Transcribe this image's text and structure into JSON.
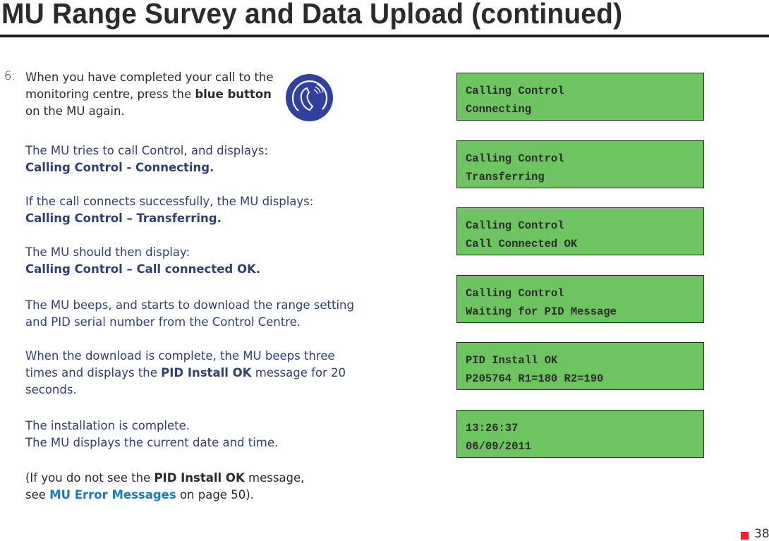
{
  "page": {
    "title": "MU Range Survey and Data Upload (continued)",
    "page_number": "38"
  },
  "step": {
    "number": "6.",
    "intro_1": "When you have completed your call to the",
    "intro_2a": "monitoring centre, press the ",
    "intro_2b": "blue button",
    "intro_3": "on the MU again.",
    "button_icon": "phone-handset-icon",
    "p1_text": "The MU tries to call Control, and displays:",
    "p1_bold": "Calling Control - Connecting.",
    "p2_text": "If the call connects successfully, the MU displays:",
    "p2_bold": "Calling Control – Transferring.",
    "p3_text": "The MU should then display:",
    "p3_bold": "Calling Control – Call connected OK.",
    "p4_line1": "The MU beeps, and starts to download the range setting",
    "p4_line2": "and PID serial number from the Control Centre.",
    "p5_line1": "When the download is complete, the MU beeps three",
    "p5_line2a": "times and displays the ",
    "p5_line2b": "PID Install OK",
    "p5_line2c": " message for 20",
    "p5_line3": "seconds.",
    "p6_line1": "The installation is complete.",
    "p6_line2": "The MU displays the current date and time.",
    "p7_line1a": "(If you do not see the ",
    "p7_line1b": "PID Install OK",
    "p7_line1c": " message,",
    "p7_line2a": "see ",
    "p7_link": "MU Error Messages",
    "p7_line2c": " on page 50)."
  },
  "displays": [
    {
      "line1": "Calling Control",
      "line2": "Connecting"
    },
    {
      "line1": "Calling Control",
      "line2": "Transferring"
    },
    {
      "line1": "Calling Control",
      "line2": "Call Connected OK"
    },
    {
      "line1": "Calling Control",
      "line2": "Waiting for PID Message"
    },
    {
      "line1": "PID Install OK",
      "line2": "P205764 R1=180 R2=190"
    },
    {
      "line1": "13:26:37",
      "line2": "06/09/2011"
    }
  ],
  "colors": {
    "lcd_green": "#6ec461",
    "button_blue": "#3040a0",
    "body_navy": "#2f3f73",
    "link_blue": "#1a7bbf",
    "page_marker_red": "#e8242c"
  }
}
